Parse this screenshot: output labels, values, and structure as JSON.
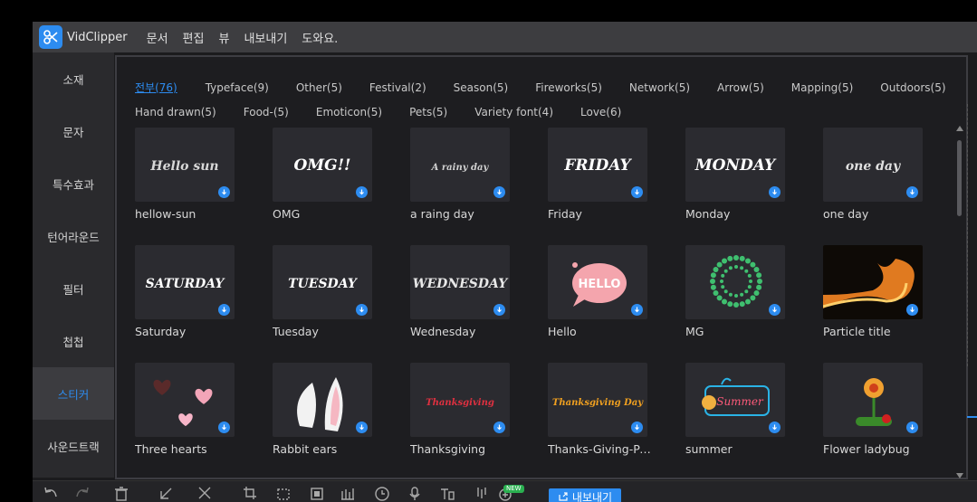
{
  "app": {
    "name": "VidClipper"
  },
  "menu": [
    "문서",
    "편집",
    "뷰",
    "내보내기",
    "도와요."
  ],
  "sidebar": {
    "items": [
      "소재",
      "문자",
      "특수효과",
      "턴어라운드",
      "필터",
      "첩첩",
      "스티커",
      "사운드트랙"
    ],
    "active": "스티커"
  },
  "tabs": {
    "row1": [
      "전부(76)",
      "Typeface(9)",
      "Other(5)",
      "Festival(2)",
      "Season(5)",
      "Fireworks(5)",
      "Network(5)",
      "Arrow(5)",
      "Mapping(5)",
      "Outdoors(5)"
    ],
    "row2": [
      "Hand drawn(5)",
      "Food-(5)",
      "Emoticon(5)",
      "Pets(5)",
      "Variety font(4)",
      "Love(6)"
    ],
    "active": "전부(76)"
  },
  "stickers": [
    {
      "label": "hellow-sun",
      "art": "Hello sun",
      "icon": "script-text"
    },
    {
      "label": "OMG",
      "art": "OMG!!",
      "icon": "script-text"
    },
    {
      "label": "a raing day",
      "art": "A rainy day",
      "icon": "script-text"
    },
    {
      "label": "Friday",
      "art": "FRIDAY",
      "icon": "script-text"
    },
    {
      "label": "Monday",
      "art": "MONDAY",
      "icon": "script-text"
    },
    {
      "label": "one day",
      "art": "one day",
      "icon": "script-text"
    },
    {
      "label": "Saturday",
      "art": "SATURDAY",
      "icon": "script-text"
    },
    {
      "label": "Tuesday",
      "art": "TUESDAY",
      "icon": "script-text"
    },
    {
      "label": "Wednesday",
      "art": "WEDNESDAY",
      "icon": "script-text"
    },
    {
      "label": "Hello",
      "art": "HELLO",
      "icon": "speech-bubble"
    },
    {
      "label": "MG",
      "art": "",
      "icon": "dot-circle"
    },
    {
      "label": "Particle title",
      "art": "",
      "icon": "fire-particles"
    },
    {
      "label": "Three hearts",
      "art": "",
      "icon": "hearts"
    },
    {
      "label": "Rabbit ears",
      "art": "",
      "icon": "rabbit-ears"
    },
    {
      "label": "Thanksgiving",
      "art": "Thanksgiving",
      "icon": "script-text"
    },
    {
      "label": "Thanks-Giving-Pa...",
      "art": "Thanksgiving Day",
      "icon": "script-text"
    },
    {
      "label": "summer",
      "art": "Summer",
      "icon": "summer-sign"
    },
    {
      "label": "Flower ladybug",
      "art": "",
      "icon": "flower"
    }
  ],
  "toolbar": {
    "export_label": "내보내기",
    "new_badge": "NEW"
  },
  "colors": {
    "accent": "#2d8cf0",
    "panel": "#1d1d20",
    "sidebar": "#2a2a2d",
    "titlebar": "#3d3d40"
  }
}
